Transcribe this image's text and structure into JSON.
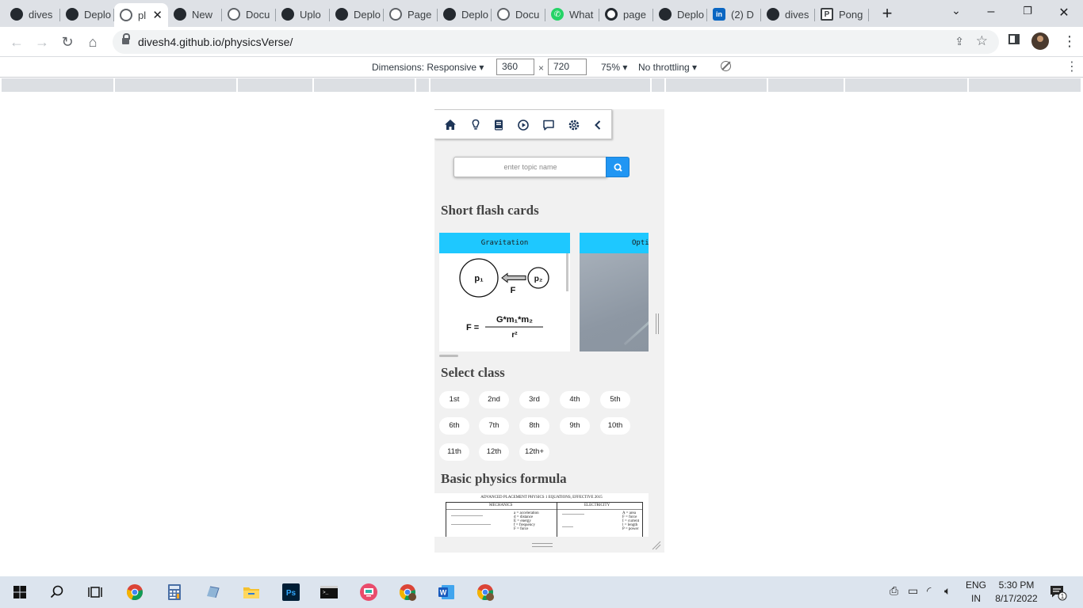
{
  "browser": {
    "tabs": [
      {
        "title": "dives",
        "icon": "github-icon",
        "active": false
      },
      {
        "title": "Deplo",
        "icon": "github-icon",
        "active": false
      },
      {
        "title": "pl",
        "icon": "globe-icon",
        "active": true
      },
      {
        "title": "New",
        "icon": "github-icon",
        "active": false
      },
      {
        "title": "Docu",
        "icon": "globe-icon",
        "active": false
      },
      {
        "title": "Uplo",
        "icon": "github-icon",
        "active": false
      },
      {
        "title": "Deplo",
        "icon": "github-icon",
        "active": false
      },
      {
        "title": "Page",
        "icon": "globe-icon",
        "active": false
      },
      {
        "title": "Deplo",
        "icon": "github-icon",
        "active": false
      },
      {
        "title": "Docu",
        "icon": "globe-icon",
        "active": false
      },
      {
        "title": "What",
        "icon": "whatsapp-icon",
        "active": false
      },
      {
        "title": "page",
        "icon": "github-circle-icon",
        "active": false
      },
      {
        "title": "Deplo",
        "icon": "github-icon",
        "active": false
      },
      {
        "title": "(2) D",
        "icon": "linkedin-icon",
        "active": false
      },
      {
        "title": "dives",
        "icon": "github-icon",
        "active": false
      },
      {
        "title": "Pong",
        "icon": "pong-icon",
        "active": false
      }
    ],
    "address_bar": {
      "url": "divesh4.github.io/physicsVerse/"
    }
  },
  "devtools": {
    "dimensions_label": "Dimensions: Responsive",
    "width": "360",
    "height": "720",
    "times": "×",
    "zoom": "75%",
    "throttling": "No throttling"
  },
  "page": {
    "nav_icons": [
      "home-icon",
      "lightbulb-icon",
      "book-icon",
      "play-icon",
      "chat-icon",
      "settings-icon",
      "back-icon"
    ],
    "search": {
      "placeholder": "enter topic name"
    },
    "flash_cards_heading": "Short flash cards",
    "cards": [
      {
        "title": "Gravitation",
        "p1": "p₁",
        "p2": "p₂",
        "force": "F",
        "formula_lhs": "F =",
        "formula_num": "G*m₁*m₂",
        "formula_den": "r²"
      },
      {
        "title": "Opti"
      }
    ],
    "select_class_heading": "Select class",
    "classes": [
      "1st",
      "2nd",
      "3rd",
      "4th",
      "5th",
      "6th",
      "7th",
      "8th",
      "9th",
      "10th",
      "11th",
      "12th",
      "12th+"
    ],
    "formula_heading": "Basic physics formula",
    "formula_sheet": {
      "title": "ADVANCED PLACEMENT PHYSICS 1 EQUATIONS, EFFECTIVE 2015",
      "left_header": "MECHANICS",
      "right_header": "ELECTRICITY",
      "left_legend": [
        "a = acceleration",
        "d = distance",
        "E = energy",
        "f = frequency",
        "F = force"
      ],
      "right_legend": [
        "A = area",
        "F = force",
        "I = current",
        "l = length",
        "P = power"
      ]
    }
  },
  "taskbar": {
    "language": "ENG",
    "region": "IN",
    "time": "5:30 PM",
    "date": "8/17/2022",
    "notification_count": "1"
  }
}
